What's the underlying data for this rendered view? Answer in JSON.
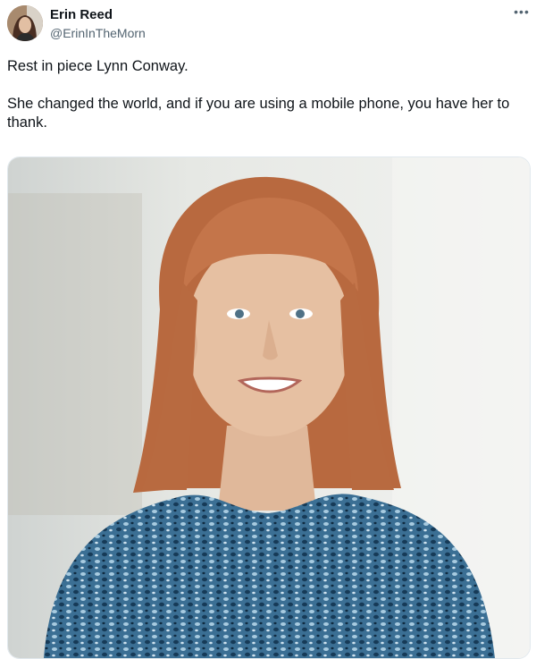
{
  "tweet": {
    "author": {
      "name": "Erin Reed",
      "handle": "@ErinInTheMorn"
    },
    "more_icon": "more-horizontal-icon",
    "text_lines": [
      "Rest in piece Lynn Conway.",
      "She changed the world, and if you are using a mobile phone, you have her to thank."
    ]
  },
  "colors": {
    "text": "#0f1419",
    "secondary": "#536471",
    "hair": "#c0704a",
    "blouse": "#2f5f82"
  }
}
